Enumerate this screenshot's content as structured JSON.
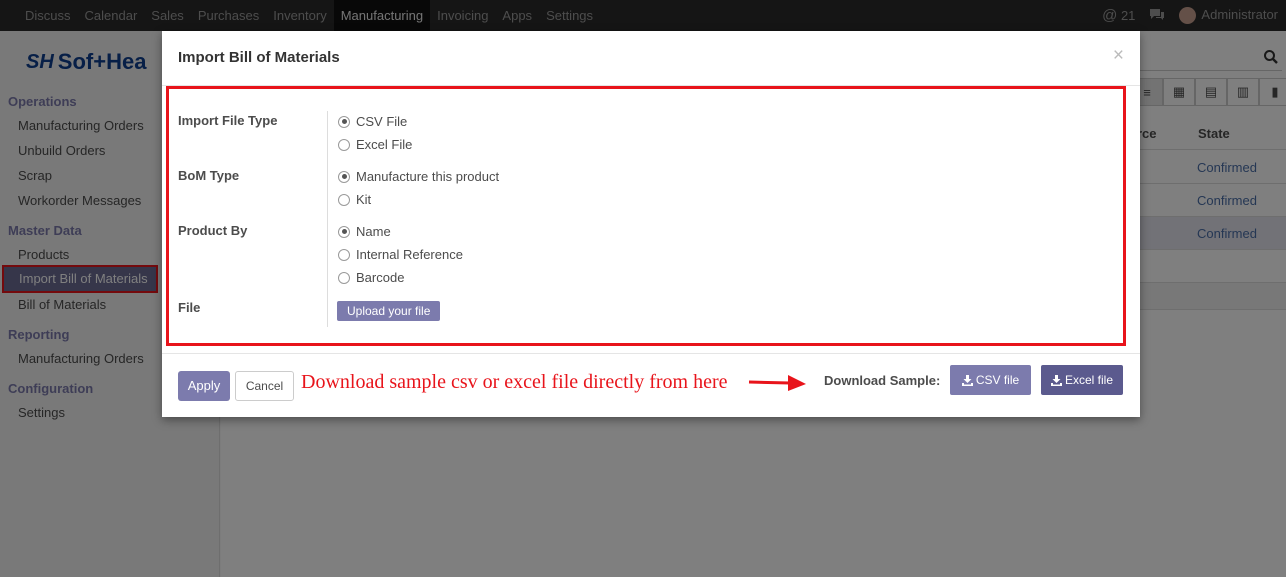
{
  "topnav": {
    "menu": [
      "Discuss",
      "Calendar",
      "Sales",
      "Purchases",
      "Inventory",
      "Manufacturing",
      "Invoicing",
      "Apps",
      "Settings"
    ],
    "active": "Manufacturing",
    "messages_count": "21",
    "user": "Administrator"
  },
  "logo": {
    "text": "Sof+Hea"
  },
  "sidebar": {
    "operations": "Operations",
    "manufacturing_orders": "Manufacturing Orders",
    "unbuild_orders": "Unbuild Orders",
    "scrap": "Scrap",
    "workorder_messages": "Workorder Messages",
    "master_data": "Master Data",
    "products": "Products",
    "import_bom": "Import Bill of Materials",
    "bill_of_materials": "Bill of Materials",
    "reporting": "Reporting",
    "reporting_mo": "Manufacturing Orders",
    "configuration": "Configuration",
    "settings": "Settings"
  },
  "table": {
    "col_source_partial": "rce",
    "col_state": "State",
    "rows": [
      "Confirmed",
      "Confirmed",
      "Confirmed"
    ]
  },
  "modal": {
    "title": "Import Bill of Materials",
    "close": "×",
    "import_file_type_label": "Import File Type",
    "file_type_options": [
      "CSV File",
      "Excel File"
    ],
    "bom_type_label": "BoM Type",
    "bom_type_options": [
      "Manufacture this product",
      "Kit"
    ],
    "product_by_label": "Product By",
    "product_by_options": [
      "Name",
      "Internal Reference",
      "Barcode"
    ],
    "file_label": "File",
    "upload_label": "Upload your file",
    "apply_label": "Apply",
    "cancel_label": "Cancel",
    "annotation": "Download sample csv or excel file directly from here",
    "download_sample_label": "Download Sample:",
    "csv_button": "CSV file",
    "excel_button": "Excel file"
  },
  "colors": {
    "accent": "#7c7bad",
    "highlight": "#e8141b",
    "link": "#4b6fa8"
  }
}
